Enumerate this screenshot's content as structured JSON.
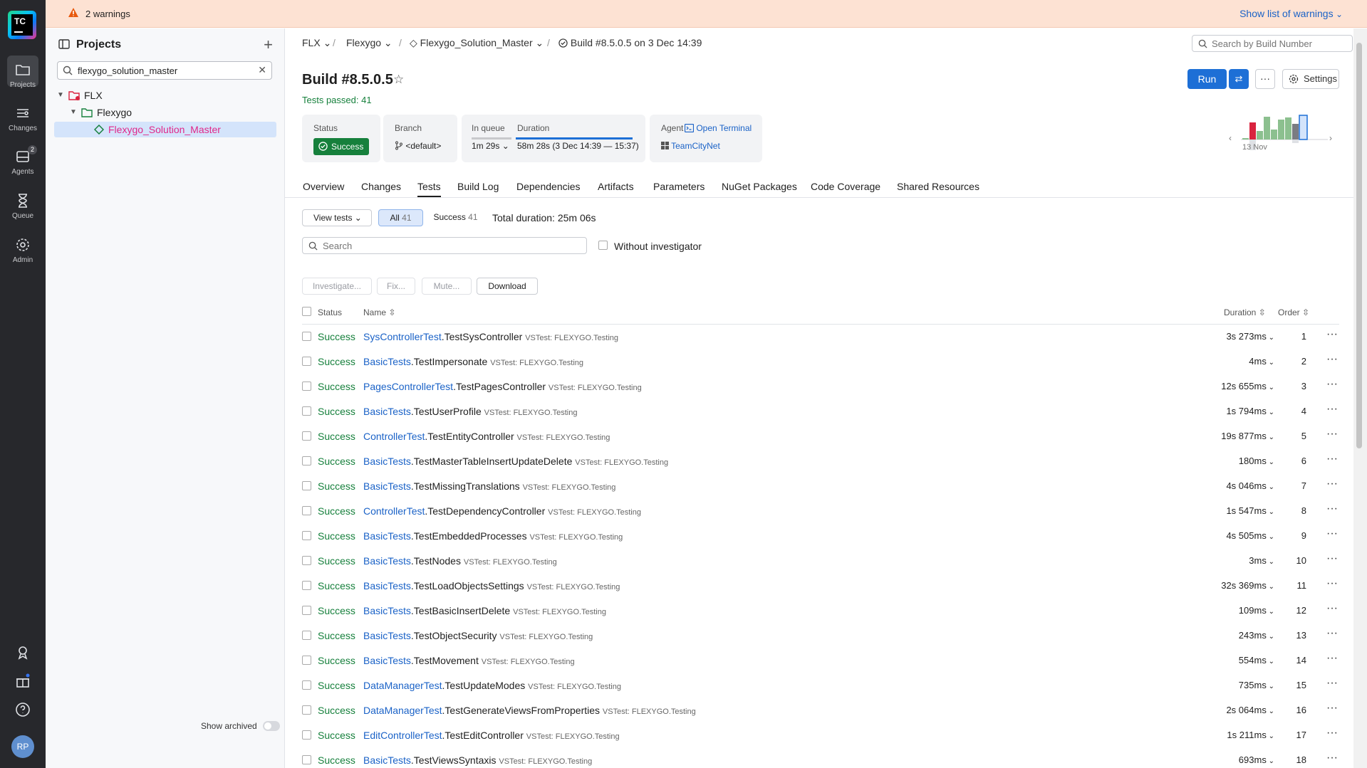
{
  "warnings": {
    "text": "2 warnings",
    "link": "Show list of warnings"
  },
  "rail": {
    "logo": "TC",
    "items": [
      {
        "label": "Projects"
      },
      {
        "label": "Changes"
      },
      {
        "label": "Agents",
        "badge": "2"
      },
      {
        "label": "Queue"
      },
      {
        "label": "Admin"
      }
    ],
    "avatar": "RP"
  },
  "sidebar": {
    "title": "Projects",
    "search_value": "flexygo_solution_master",
    "tree": [
      {
        "label": "FLX"
      },
      {
        "label": "Flexygo"
      },
      {
        "label": "Flexygo_Solution_Master"
      }
    ],
    "show_archived": "Show archived"
  },
  "breadcrumb": {
    "items": [
      "FLX",
      "Flexygo",
      "Flexygo_Solution_Master",
      "Build #8.5.0.5 on 3 Dec 14:39"
    ],
    "search_placeholder": "Search by Build Number"
  },
  "build": {
    "title": "Build #8.5.0.5",
    "tests_passed": "Tests passed: 41",
    "run_label": "Run",
    "settings_label": "Settings",
    "status_label": "Status",
    "status_value": "Success",
    "branch_label": "Branch",
    "branch_value": "<default>",
    "queue_label": "In queue",
    "queue_value": "1m 29s",
    "duration_label": "Duration",
    "duration_value": "58m 28s (3 Dec 14:39 — 15:37)",
    "agent_label": "Agent",
    "open_terminal": "Open Terminal",
    "agent_name": "TeamCityNet",
    "history_label": "13 Nov"
  },
  "colors": {
    "success": "#16803c",
    "link": "#1a62c7",
    "primary": "#1d6fd6",
    "warning_bg": "#fde2d3"
  },
  "tabs": [
    "Overview",
    "Changes",
    "Tests",
    "Build Log",
    "Dependencies",
    "Artifacts",
    "Parameters",
    "NuGet Packages",
    "Code Coverage",
    "Shared Resources"
  ],
  "tests": {
    "view_tests": "View tests",
    "filter_all": "All",
    "filter_all_count": "41",
    "filter_success": "Success",
    "filter_success_count": "41",
    "total_duration": "Total duration: 25m 06s",
    "search_placeholder": "Search",
    "without_investigator": "Without investigator",
    "actions": [
      "Investigate...",
      "Fix...",
      "Mute...",
      "Download"
    ],
    "columns": {
      "status": "Status",
      "name": "Name",
      "duration": "Duration",
      "order": "Order"
    },
    "rows": [
      {
        "status": "Success",
        "cls": "SysControllerTest",
        "test": ".TestSysController",
        "source": "VSTest: FLEXYGO.Testing",
        "duration": "3s 273ms",
        "order": "1"
      },
      {
        "status": "Success",
        "cls": "BasicTests",
        "test": ".TestImpersonate",
        "source": "VSTest: FLEXYGO.Testing",
        "duration": "4ms",
        "order": "2"
      },
      {
        "status": "Success",
        "cls": "PagesControllerTest",
        "test": ".TestPagesController",
        "source": "VSTest: FLEXYGO.Testing",
        "duration": "12s 655ms",
        "order": "3"
      },
      {
        "status": "Success",
        "cls": "BasicTests",
        "test": ".TestUserProfile",
        "source": "VSTest: FLEXYGO.Testing",
        "duration": "1s 794ms",
        "order": "4"
      },
      {
        "status": "Success",
        "cls": "ControllerTest",
        "test": ".TestEntityController",
        "source": "VSTest: FLEXYGO.Testing",
        "duration": "19s 877ms",
        "order": "5"
      },
      {
        "status": "Success",
        "cls": "BasicTests",
        "test": ".TestMasterTableInsertUpdateDelete",
        "source": "VSTest: FLEXYGO.Testing",
        "duration": "180ms",
        "order": "6"
      },
      {
        "status": "Success",
        "cls": "BasicTests",
        "test": ".TestMissingTranslations",
        "source": "VSTest: FLEXYGO.Testing",
        "duration": "4s 046ms",
        "order": "7"
      },
      {
        "status": "Success",
        "cls": "ControllerTest",
        "test": ".TestDependencyController",
        "source": "VSTest: FLEXYGO.Testing",
        "duration": "1s 547ms",
        "order": "8"
      },
      {
        "status": "Success",
        "cls": "BasicTests",
        "test": ".TestEmbeddedProcesses",
        "source": "VSTest: FLEXYGO.Testing",
        "duration": "4s 505ms",
        "order": "9"
      },
      {
        "status": "Success",
        "cls": "BasicTests",
        "test": ".TestNodes",
        "source": "VSTest: FLEXYGO.Testing",
        "duration": "3ms",
        "order": "10"
      },
      {
        "status": "Success",
        "cls": "BasicTests",
        "test": ".TestLoadObjectsSettings",
        "source": "VSTest: FLEXYGO.Testing",
        "duration": "32s 369ms",
        "order": "11"
      },
      {
        "status": "Success",
        "cls": "BasicTests",
        "test": ".TestBasicInsertDelete",
        "source": "VSTest: FLEXYGO.Testing",
        "duration": "109ms",
        "order": "12"
      },
      {
        "status": "Success",
        "cls": "BasicTests",
        "test": ".TestObjectSecurity",
        "source": "VSTest: FLEXYGO.Testing",
        "duration": "243ms",
        "order": "13"
      },
      {
        "status": "Success",
        "cls": "BasicTests",
        "test": ".TestMovement",
        "source": "VSTest: FLEXYGO.Testing",
        "duration": "554ms",
        "order": "14"
      },
      {
        "status": "Success",
        "cls": "DataManagerTest",
        "test": ".TestUpdateModes",
        "source": "VSTest: FLEXYGO.Testing",
        "duration": "735ms",
        "order": "15"
      },
      {
        "status": "Success",
        "cls": "DataManagerTest",
        "test": ".TestGenerateViewsFromProperties",
        "source": "VSTest: FLEXYGO.Testing",
        "duration": "2s 064ms",
        "order": "16"
      },
      {
        "status": "Success",
        "cls": "EditControllerTest",
        "test": ".TestEditController",
        "source": "VSTest: FLEXYGO.Testing",
        "duration": "1s 211ms",
        "order": "17"
      },
      {
        "status": "Success",
        "cls": "BasicTests",
        "test": ".TestViewsSyntaxis",
        "source": "VSTest: FLEXYGO.Testing",
        "duration": "693ms",
        "order": "18"
      }
    ]
  }
}
